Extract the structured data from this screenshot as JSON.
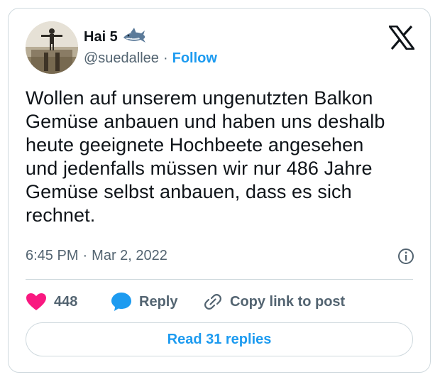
{
  "author": {
    "display_name": "Hai 5",
    "badge_icon": "shark-emoji-icon",
    "handle": "@suedallee",
    "separator": "·",
    "follow_label": "Follow"
  },
  "brand_icon": "x-logo-icon",
  "tweet": {
    "text": "Wollen auf unserem ungenutzten Balkon\nGemüse anbauen und haben uns deshalb\nheute geeignete Hochbeete angesehen\nund jedenfalls müssen wir nur 486 Jahre\nGemüse selbst anbauen, dass es sich\nrechnet.",
    "time": "6:45 PM",
    "separator": "·",
    "date": "Mar 2, 2022"
  },
  "actions": {
    "like_count": "448",
    "reply_label": "Reply",
    "copy_link_label": "Copy link to post"
  },
  "read_replies_label": "Read 31 replies",
  "colors": {
    "like": "#f91880",
    "reply": "#1d9bf0",
    "link": "#1d9bf0",
    "muted": "#536471",
    "border": "#cfd9de"
  }
}
